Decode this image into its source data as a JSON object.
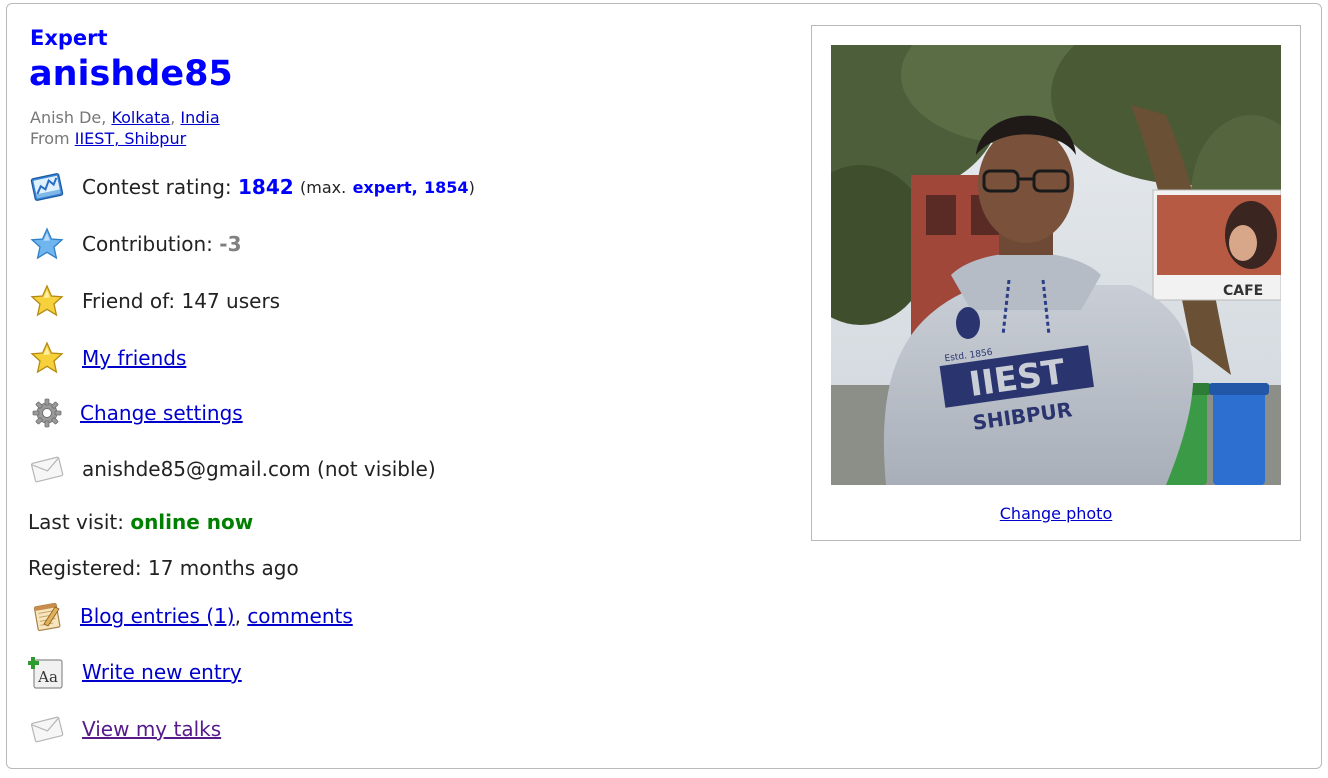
{
  "profile": {
    "rank": "Expert",
    "handle": "anishde85",
    "name": "Anish De",
    "name_sep": ", ",
    "city": "Kolkata",
    "city_sep": ", ",
    "country": "India",
    "from_label": "From",
    "organization": "IIEST, Shibpur",
    "handle_color": "#0000ff"
  },
  "rating": {
    "label": "Contest rating:",
    "value": "1842",
    "max_prefix": "(max.",
    "max_rank": "expert,",
    "max_value": "1854",
    "max_suffix": ")"
  },
  "contribution": {
    "label": "Contribution:",
    "value": "-3"
  },
  "friend_of": {
    "text": "Friend of: 147 users"
  },
  "my_friends": {
    "label": "My friends"
  },
  "settings": {
    "label": "Change settings"
  },
  "email": {
    "text": "anishde85@gmail.com (not visible)"
  },
  "last_visit": {
    "label": "Last visit:",
    "value": "online now",
    "color": "#008000"
  },
  "registered": {
    "text": "Registered: 17 months ago"
  },
  "blog": {
    "entries_label": "Blog entries (1)",
    "sep": ",",
    "comments_label": "comments"
  },
  "write_entry": {
    "label": "Write new entry"
  },
  "talks": {
    "label": "View my talks"
  },
  "photo": {
    "change_label": "Change photo",
    "sweatshirt_logo": "IIEST",
    "sweatshirt_sub": "SHIBPUR",
    "sweatshirt_estd": "Estd. 1856",
    "sign_text": "CAFE"
  },
  "icons": {
    "rating": "rating-chart-icon",
    "contribution": "blue-star-icon",
    "friend_of": "gold-star-icon",
    "my_friends": "gold-star-icon",
    "settings": "gear-icon",
    "email": "envelope-icon",
    "blog": "blog-notepad-icon",
    "write": "write-entry-icon",
    "talks": "envelope-icon"
  }
}
